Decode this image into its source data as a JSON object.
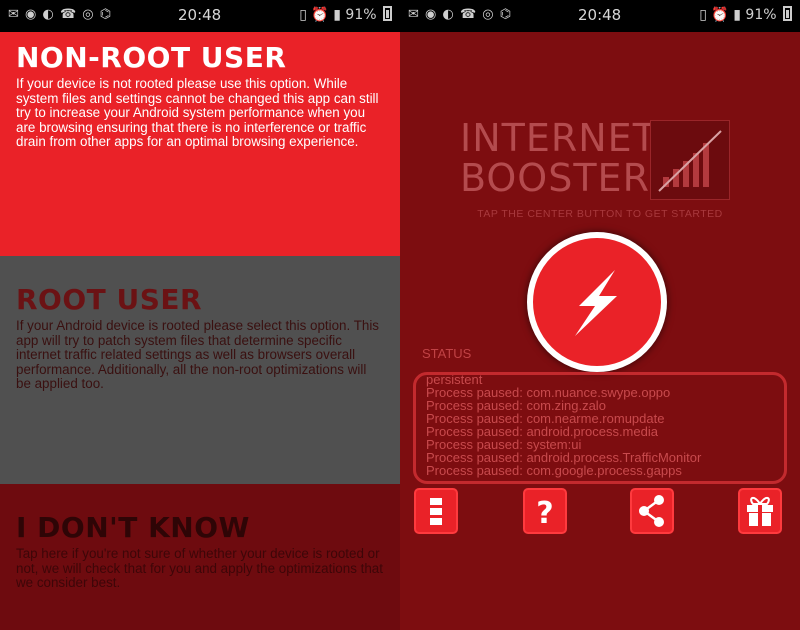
{
  "status_bar": {
    "time": "20:48",
    "battery": "91%",
    "left_icons": [
      "notification-icons"
    ],
    "right_icons": [
      "sim-icon",
      "alarm-icon"
    ]
  },
  "left_screen": {
    "options": [
      {
        "title": "NON-ROOT USER",
        "description": "If your device is not rooted please use this option. While system files and settings cannot be changed this app can still try to increase your Android system performance when you are browsing ensuring that there is no interference or traffic drain from other apps for an optimal browsing experience.",
        "color": "#ea2228"
      },
      {
        "title": "ROOT USER",
        "description": "If your Android device is rooted please select this option. This app will try to patch system files that determine specific internet traffic related settings as well as browsers overall performance. Additionally, all the non-root optimizations will be applied too.",
        "color": "#505050"
      },
      {
        "title": "I DON'T KNOW",
        "description": "Tap here if you're not sure of whether your device is rooted or not, we will check that for you and apply the optimizations that we consider best.",
        "color": "#6e0b0f"
      }
    ]
  },
  "right_screen": {
    "brand_line1": "INTERNET",
    "brand_line2": "BOOSTER",
    "tagline": "TAP THE CENTER BUTTON TO GET STARTED",
    "status_label": "STATUS",
    "status_lines": [
      "persistent",
      "Process paused: com.nuance.swype.oppo",
      "Process paused: com.zing.zalo",
      "Process paused: com.nearme.romupdate",
      "Process paused: android.process.media",
      "Process paused: system:ui",
      "Process paused: android.process.TrafficMonitor",
      "Process paused: com.google.process.gapps"
    ],
    "toolbar": [
      "menu-icon",
      "help-icon",
      "share-icon",
      "gift-icon"
    ],
    "accent": "#ea2228"
  }
}
